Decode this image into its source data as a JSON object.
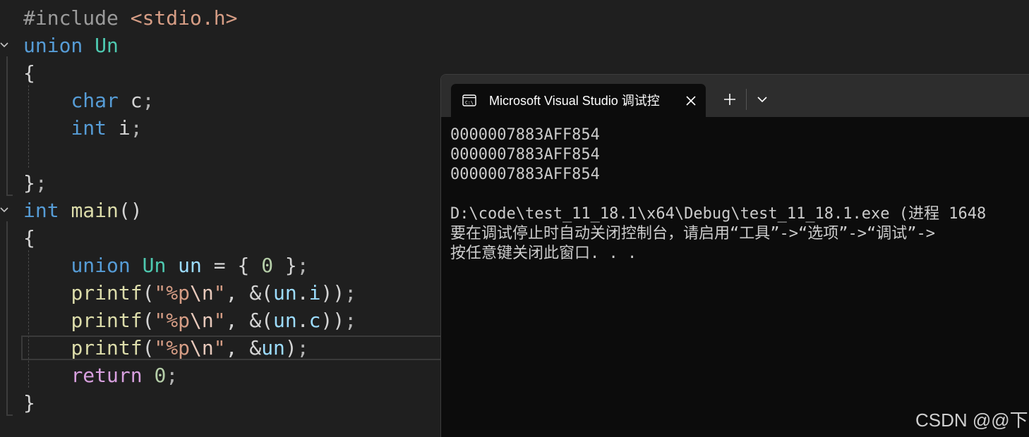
{
  "editor": {
    "lines": [
      {
        "parts": [
          {
            "t": "#include ",
            "c": "pp"
          },
          {
            "t": "<stdio.h>",
            "c": "st"
          }
        ]
      },
      {
        "parts": [
          {
            "t": "union",
            "c": "kw"
          },
          {
            "t": " "
          },
          {
            "t": "Un",
            "c": "ty"
          }
        ]
      },
      {
        "parts": [
          {
            "t": "{",
            "c": "pn"
          }
        ]
      },
      {
        "parts": [
          {
            "t": "    "
          },
          {
            "t": "char",
            "c": "kw"
          },
          {
            "t": " c",
            "c": "pn"
          },
          {
            "t": ";",
            "c": "gy"
          }
        ]
      },
      {
        "parts": [
          {
            "t": "    "
          },
          {
            "t": "int",
            "c": "kw"
          },
          {
            "t": " i",
            "c": "pn"
          },
          {
            "t": ";",
            "c": "gy"
          }
        ]
      },
      {
        "parts": [
          {
            "t": ""
          }
        ]
      },
      {
        "parts": [
          {
            "t": "}",
            "c": "pn"
          },
          {
            "t": ";",
            "c": "gy"
          }
        ]
      },
      {
        "parts": [
          {
            "t": "int",
            "c": "kw"
          },
          {
            "t": " "
          },
          {
            "t": "main",
            "c": "fn"
          },
          {
            "t": "()",
            "c": "pn"
          }
        ]
      },
      {
        "parts": [
          {
            "t": "{",
            "c": "pn"
          }
        ]
      },
      {
        "parts": [
          {
            "t": "    "
          },
          {
            "t": "union",
            "c": "kw"
          },
          {
            "t": " "
          },
          {
            "t": "Un",
            "c": "ty"
          },
          {
            "t": " "
          },
          {
            "t": "un",
            "c": "vr"
          },
          {
            "t": " = { ",
            "c": "pn"
          },
          {
            "t": "0",
            "c": "nu"
          },
          {
            "t": " }",
            "c": "pn"
          },
          {
            "t": ";",
            "c": "gy"
          }
        ]
      },
      {
        "parts": [
          {
            "t": "    "
          },
          {
            "t": "printf",
            "c": "fn"
          },
          {
            "t": "(",
            "c": "pn"
          },
          {
            "t": "\"%p",
            "c": "st"
          },
          {
            "t": "\\n",
            "c": "es"
          },
          {
            "t": "\"",
            "c": "st"
          },
          {
            "t": ", &(",
            "c": "pn"
          },
          {
            "t": "un",
            "c": "vr"
          },
          {
            "t": ".",
            "c": "pn"
          },
          {
            "t": "i",
            "c": "vr"
          },
          {
            "t": "))",
            "c": "pn"
          },
          {
            "t": ";",
            "c": "gy"
          }
        ]
      },
      {
        "parts": [
          {
            "t": "    "
          },
          {
            "t": "printf",
            "c": "fn"
          },
          {
            "t": "(",
            "c": "pn"
          },
          {
            "t": "\"%p",
            "c": "st"
          },
          {
            "t": "\\n",
            "c": "es"
          },
          {
            "t": "\"",
            "c": "st"
          },
          {
            "t": ", &(",
            "c": "pn"
          },
          {
            "t": "un",
            "c": "vr"
          },
          {
            "t": ".",
            "c": "pn"
          },
          {
            "t": "c",
            "c": "vr"
          },
          {
            "t": "))",
            "c": "pn"
          },
          {
            "t": ";",
            "c": "gy"
          }
        ]
      },
      {
        "parts": [
          {
            "t": "    "
          },
          {
            "t": "printf",
            "c": "fn"
          },
          {
            "t": "(",
            "c": "pn"
          },
          {
            "t": "\"%p",
            "c": "st"
          },
          {
            "t": "\\n",
            "c": "es"
          },
          {
            "t": "\"",
            "c": "st"
          },
          {
            "t": ", &",
            "c": "pn"
          },
          {
            "t": "un",
            "c": "vr"
          },
          {
            "t": ")",
            "c": "pn"
          },
          {
            "t": ";",
            "c": "gy"
          }
        ]
      },
      {
        "parts": [
          {
            "t": "    "
          },
          {
            "t": "return",
            "c": "cf"
          },
          {
            "t": " "
          },
          {
            "t": "0",
            "c": "nu"
          },
          {
            "t": ";",
            "c": "gy"
          }
        ]
      },
      {
        "parts": [
          {
            "t": "}",
            "c": "pn"
          }
        ]
      }
    ],
    "fold_icon": "chevron-down-icon"
  },
  "terminal": {
    "tab_title": "Microsoft Visual Studio 调试控",
    "tab_icon": "console-icon",
    "close_icon": "close-icon",
    "new_tab_icon": "plus-icon",
    "dropdown_icon": "chevron-down-icon",
    "output_lines": [
      "0000007883AFF854",
      "0000007883AFF854",
      "0000007883AFF854",
      "",
      "D:\\code\\test_11_18.1\\x64\\Debug\\test_11_18.1.exe (进程 1648",
      "要在调试停止时自动关闭控制台，请启用“工具”->“选项”->“调试”->",
      "按任意键关闭此窗口. . ."
    ]
  },
  "watermark": "CSDN @@下"
}
